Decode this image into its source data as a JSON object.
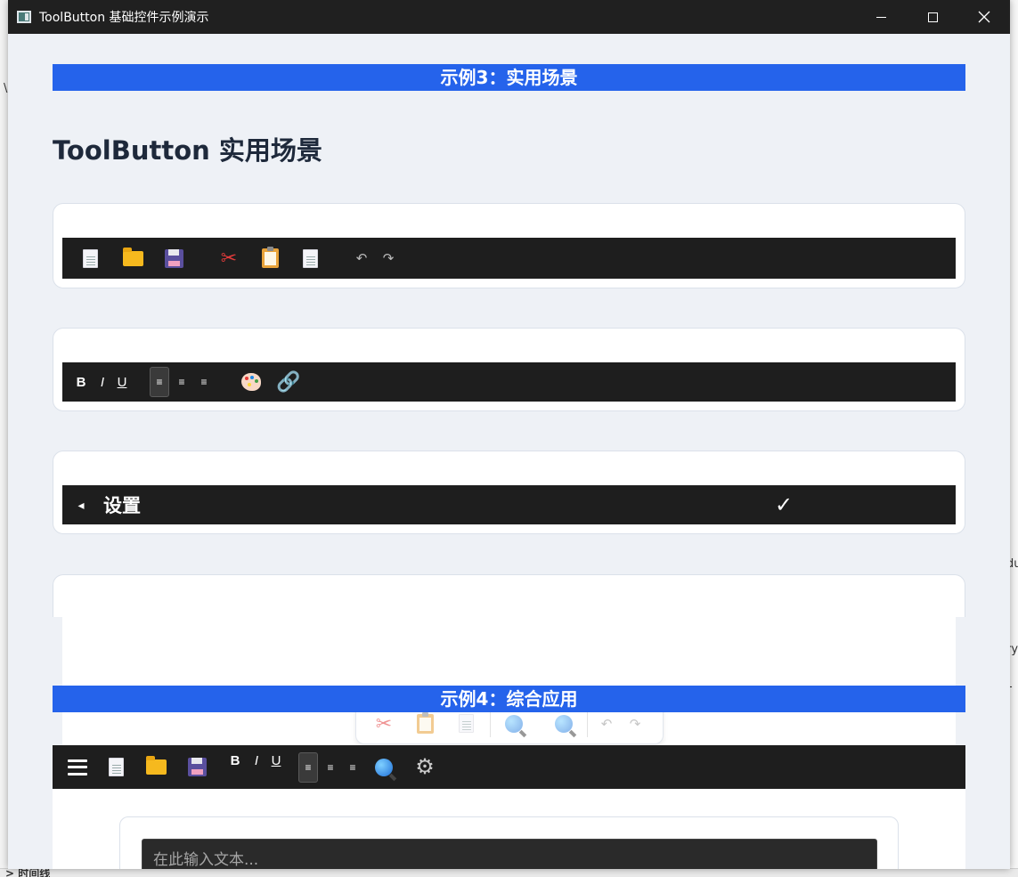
{
  "window": {
    "title": "ToolButton 基础控件示例演示"
  },
  "background": {
    "fragment_right_1": "du",
    "fragment_right_2": "ry",
    "fragment_right_3": "-",
    "fragment_bottom": "> 时间线",
    "fragment_left": "\\"
  },
  "section3": {
    "banner": "示例3：实用场景",
    "heading": "ToolButton 实用场景"
  },
  "file_toolbar": {
    "icons": [
      "new-file-icon",
      "open-folder-icon",
      "save-icon",
      "cut-icon",
      "paste-icon",
      "copy-icon",
      "undo-icon",
      "redo-icon"
    ],
    "undo_glyph": "↶",
    "redo_glyph": "↷",
    "cut_glyph": "✂"
  },
  "format_toolbar": {
    "bold": "B",
    "italic": "I",
    "underline": "U",
    "align_glyph": "≡",
    "link_glyph": "🔗"
  },
  "settings_bar": {
    "back_glyph": "◂",
    "title": "设置",
    "check_glyph": "✓"
  },
  "section4": {
    "banner": "示例4：综合应用"
  },
  "main_toolbar": {
    "bold": "B",
    "italic": "I",
    "underline": "U",
    "align_glyph": "≡",
    "gear_glyph": "⚙"
  },
  "editor": {
    "placeholder": "在此输入文本..."
  },
  "colors": {
    "accent_blue": "#2563eb",
    "toolbar_dark": "#1e1e1e",
    "page_bg": "#eef1f6"
  }
}
